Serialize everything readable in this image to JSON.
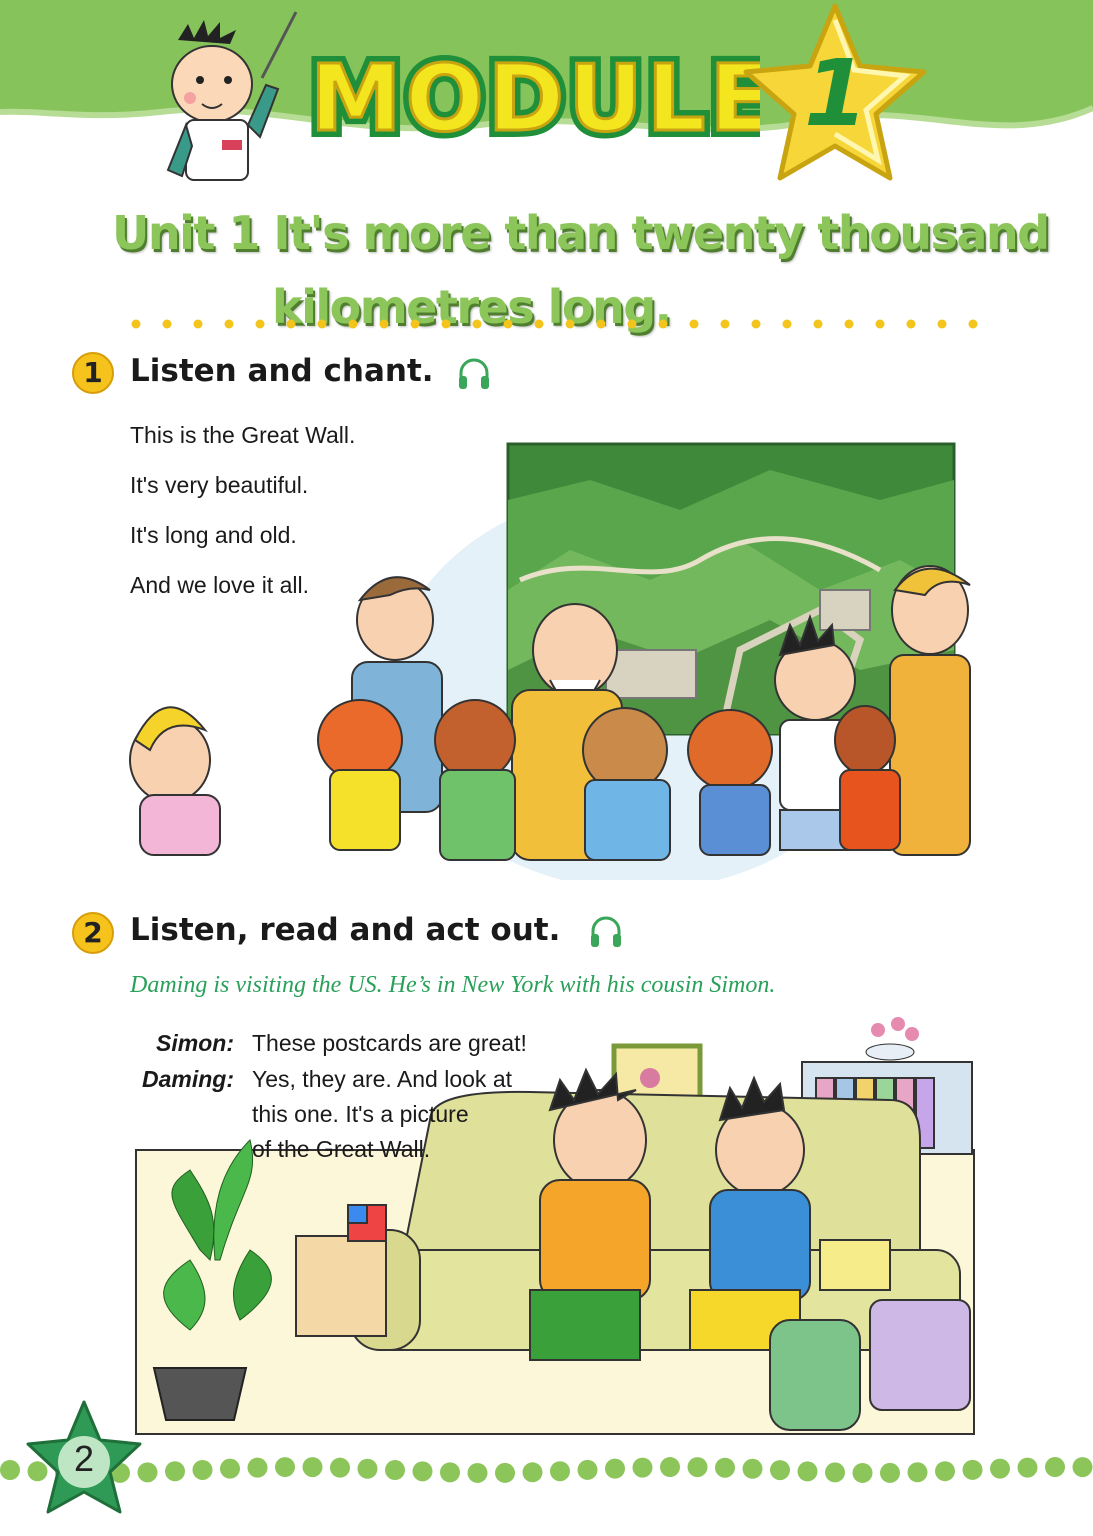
{
  "header": {
    "module_word": "MODULE",
    "module_number": "1",
    "unit_title_line1": "Unit 1  It's more than twenty thousand",
    "unit_title_line2": "kilometres long."
  },
  "section1": {
    "number": "1",
    "title": "Listen and chant.",
    "icon": "headphones-icon",
    "chant": [
      "This is the Great Wall.",
      "It's very beautiful.",
      "It's long and old.",
      "And we love it all."
    ]
  },
  "section2": {
    "number": "2",
    "title": "Listen, read and act out.",
    "icon": "headphones-icon",
    "intro": "Daming is visiting the US. He’s in New York with his cousin Simon.",
    "dialogue": [
      {
        "speaker": "Simon:",
        "lines": [
          "These postcards are great!"
        ]
      },
      {
        "speaker": "Daming:",
        "lines": [
          "Yes, they are. And look at",
          "this one. It's a picture",
          "of the Great Wall."
        ]
      }
    ]
  },
  "footer": {
    "page_number": "2"
  },
  "colors": {
    "header_green": "#86c35a",
    "title_green": "#8cc65a",
    "star_yellow": "#f7d63a",
    "number_badge": "#f6c31d",
    "intro_green": "#2aa05a",
    "dot_green": "#8cc65a",
    "dot_yellow": "#f2c41c"
  }
}
